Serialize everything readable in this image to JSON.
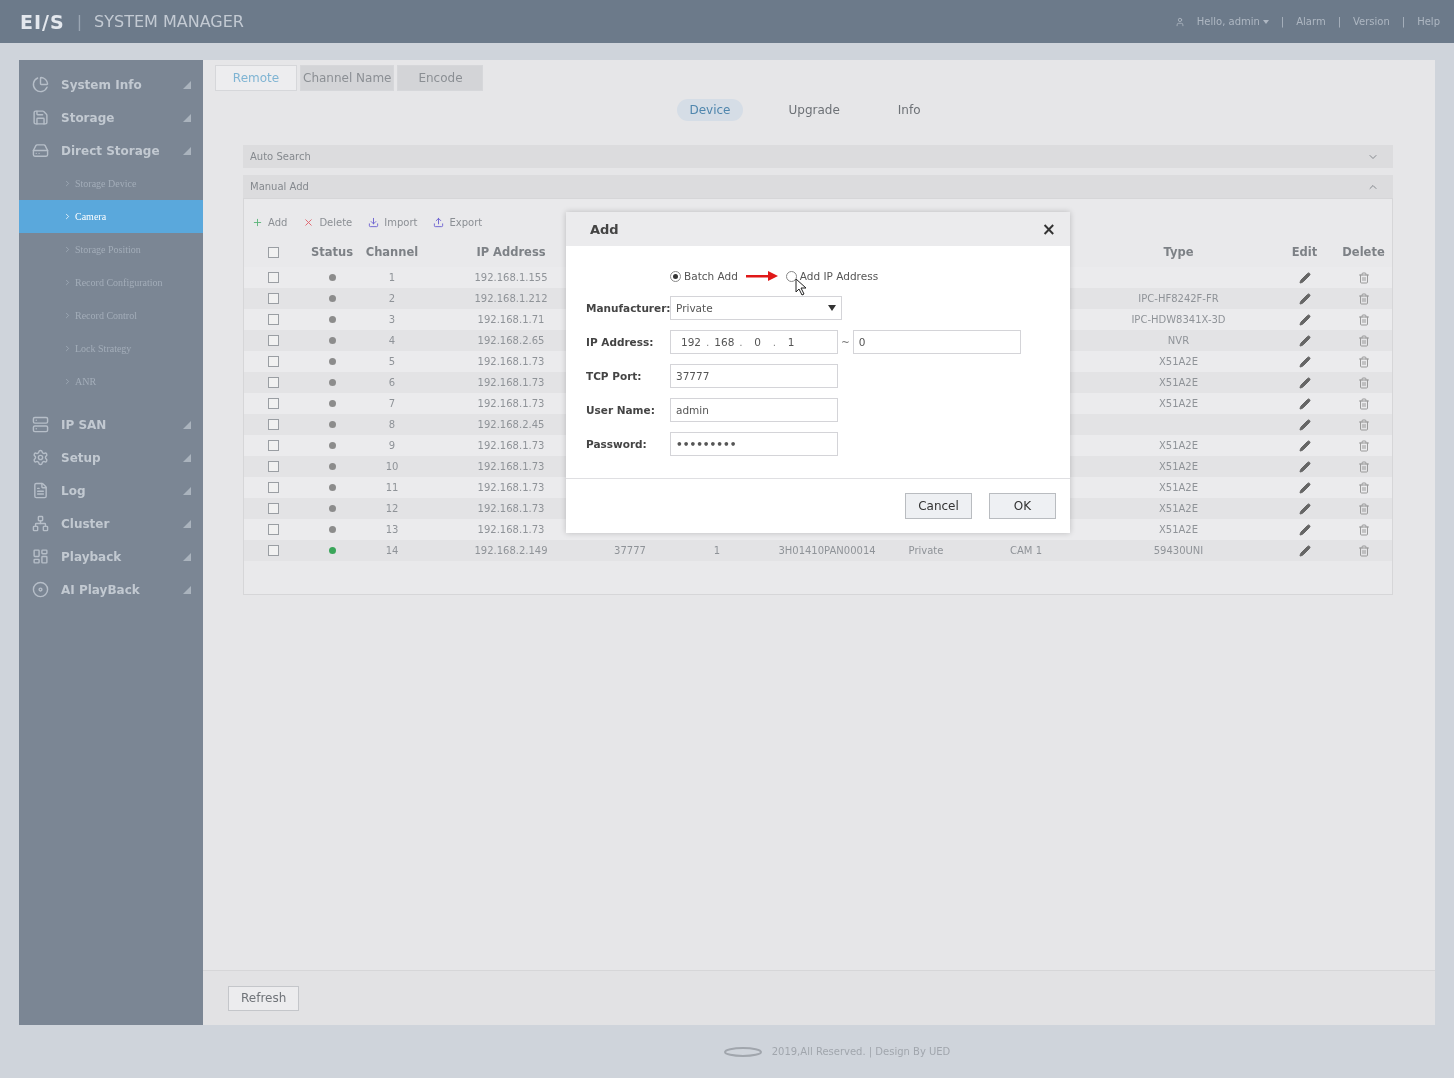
{
  "header": {
    "logo": "EI/S",
    "title_separator": "|",
    "title": "SYSTEM MANAGER",
    "user": "Hello, admin",
    "links": [
      {
        "separator": "|",
        "label": "Alarm"
      },
      {
        "separator": "|",
        "label": "Version"
      },
      {
        "separator": "|",
        "label": "Help"
      }
    ]
  },
  "sidebar": {
    "items": [
      {
        "label": "System Info"
      },
      {
        "label": "Storage"
      },
      {
        "label": "Direct Storage",
        "children": [
          {
            "label": "Storage Device",
            "selected": false
          },
          {
            "label": "Camera",
            "selected": true
          },
          {
            "label": "Storage Position",
            "selected": false
          },
          {
            "label": "Record Configuration",
            "selected": false
          },
          {
            "label": "Record Control",
            "selected": false
          },
          {
            "label": "Lock Strategy",
            "selected": false
          },
          {
            "label": "ANR",
            "selected": false
          }
        ]
      },
      {
        "label": "IP SAN"
      },
      {
        "label": "Setup"
      },
      {
        "label": "Log"
      },
      {
        "label": "Cluster"
      },
      {
        "label": "Playback"
      },
      {
        "label": "AI PlayBack"
      }
    ]
  },
  "tabs": [
    {
      "label": "Remote",
      "selected": true
    },
    {
      "label": "Channel Name",
      "selected": false
    },
    {
      "label": "Encode",
      "selected": false
    }
  ],
  "subtabs": [
    {
      "label": "Device",
      "selected": true
    },
    {
      "label": "Upgrade",
      "selected": false
    },
    {
      "label": "Info",
      "selected": false
    }
  ],
  "sections": [
    {
      "title": "Auto Search",
      "expanded": false
    },
    {
      "title": "Manual Add",
      "expanded": true
    }
  ],
  "toolbar": [
    {
      "kind": "add",
      "label": "Add"
    },
    {
      "kind": "delete",
      "label": "Delete"
    },
    {
      "kind": "import",
      "label": "Import"
    },
    {
      "kind": "export",
      "label": "Export"
    }
  ],
  "table": {
    "header_checked": false,
    "columns": {
      "status": "Status",
      "channel": "Channel",
      "ip": "IP Address",
      "type": "Type",
      "edit": "Edit",
      "delete": "Delete"
    },
    "rows": [
      {
        "checked": false,
        "color": "#8c8c8c",
        "channel": "1",
        "ip": "192.168.1.155"
      },
      {
        "checked": false,
        "color": "#8c8c8c",
        "channel": "2",
        "ip": "192.168.1.212",
        "type": "IPC-HF8242F-FR"
      },
      {
        "checked": false,
        "color": "#8c8c8c",
        "channel": "3",
        "ip": "192.168.1.71",
        "type": "IPC-HDW8341X-3D"
      },
      {
        "checked": false,
        "color": "#8c8c8c",
        "channel": "4",
        "ip": "192.168.2.65",
        "type": "NVR"
      },
      {
        "checked": false,
        "color": "#8c8c8c",
        "channel": "5",
        "ip": "192.168.1.73",
        "type": "X51A2E"
      },
      {
        "checked": false,
        "color": "#8c8c8c",
        "channel": "6",
        "ip": "192.168.1.73",
        "type": "X51A2E"
      },
      {
        "checked": false,
        "color": "#8c8c8c",
        "channel": "7",
        "ip": "192.168.1.73",
        "type": "X51A2E"
      },
      {
        "checked": false,
        "color": "#8c8c8c",
        "channel": "8",
        "ip": "192.168.2.45"
      },
      {
        "checked": false,
        "color": "#8c8c8c",
        "channel": "9",
        "ip": "192.168.1.73",
        "type": "X51A2E"
      },
      {
        "checked": false,
        "color": "#8c8c8c",
        "channel": "10",
        "ip": "192.168.1.73",
        "type": "X51A2E"
      },
      {
        "checked": false,
        "color": "#8c8c8c",
        "channel": "11",
        "ip": "192.168.1.73",
        "type": "X51A2E"
      },
      {
        "checked": false,
        "color": "#8c8c8c",
        "channel": "12",
        "ip": "192.168.1.73",
        "type": "X51A2E"
      },
      {
        "checked": false,
        "color": "#8c8c8c",
        "channel": "13",
        "ip": "192.168.1.73",
        "type": "X51A2E"
      },
      {
        "checked": false,
        "color": "#3aa65a",
        "channel": "14",
        "ip": "192.168.2.149",
        "column_5": "37777",
        "column_6": "1",
        "column_7": "3H01410PAN00014",
        "column_8": "Private",
        "column_9": "CAM 1",
        "type": "59430UNI"
      }
    ]
  },
  "dialog": {
    "title": "Add",
    "close": "×",
    "modes": [
      {
        "label": "Batch Add",
        "selected": true
      },
      {
        "label": "Add IP Address",
        "selected": false
      }
    ],
    "manufacturer": {
      "label": "Manufacturer:",
      "value": "Private"
    },
    "ip": {
      "label": "IP Address:",
      "octets": [
        "192",
        "168",
        "0",
        "1"
      ],
      "octet_separators": [
        ".",
        ".",
        "."
      ],
      "range_separator": "~",
      "range_end": "0"
    },
    "port": {
      "label": "TCP Port:",
      "value": "37777"
    },
    "user": {
      "label": "User Name:",
      "value": "admin"
    },
    "password": {
      "label": "Password:",
      "value": "•••••••••"
    },
    "buttons": [
      "Cancel",
      "OK"
    ]
  },
  "refresh": "Refresh",
  "footer": "2019,All Reserved. | Design By UED"
}
